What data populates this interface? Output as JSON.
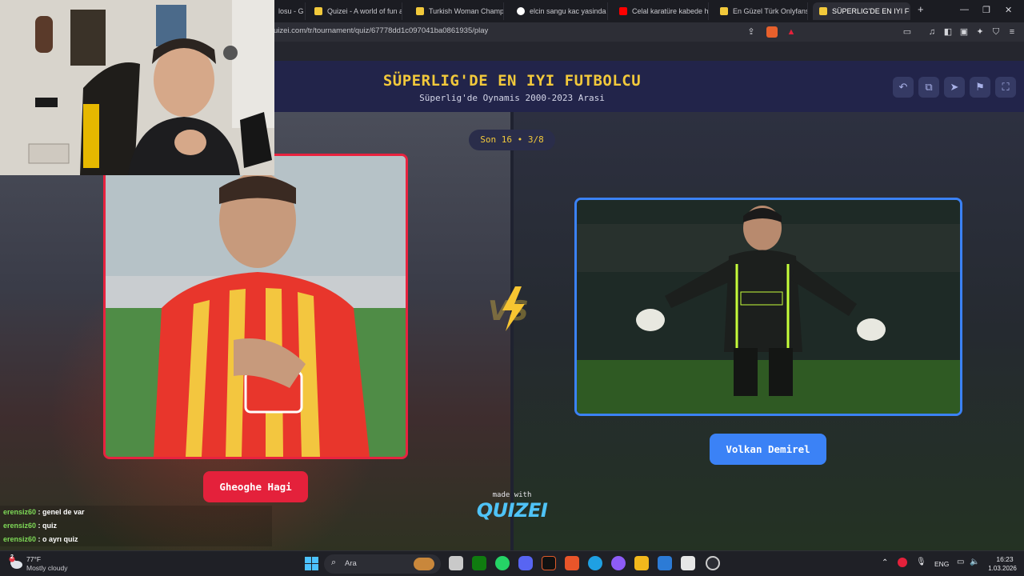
{
  "browser": {
    "tabs": [
      {
        "label": "losu - G",
        "favicon_color": "#888888"
      },
      {
        "label": "Quizei - A world of fun an",
        "favicon_color": "#f2c93b"
      },
      {
        "label": "Turkish Woman Champion",
        "favicon_color": "#f2c93b"
      },
      {
        "label": "elcin sangu kac yasinda - G",
        "favicon_color": "#ffffff"
      },
      {
        "label": "Celal karatüre kabede hac",
        "favicon_color": "#ff0000"
      },
      {
        "label": "En Güzel Türk Onlyfansc",
        "favicon_color": "#f2c93b"
      },
      {
        "label": "SÜPERLIG'DE EN IYI FU",
        "favicon_color": "#f2c93b"
      }
    ],
    "url": "uizei.com/tr/tournament/quiz/67778dd1c097041ba0861935/play",
    "window_controls": [
      "—",
      "❐",
      "✕"
    ],
    "new_tab": "+"
  },
  "quiz": {
    "title": "SÜPERLIG'DE EN IYI FUTBOLCU",
    "subtitle": "Süperlig'de Oynamis 2000-2023 Arasi",
    "round": "Son 16 • 3/8",
    "vs_text": "VS",
    "left_player": {
      "name": "Gheoghe Hagi",
      "accent": "#e4213b"
    },
    "right_player": {
      "name": "Volkan Demirel",
      "accent": "#3b82f6"
    },
    "made_with": "made with",
    "brand": "QUIZEI"
  },
  "chat": [
    {
      "user": "erensiz60",
      "message": "genel de var"
    },
    {
      "user": "erensiz60",
      "message": "quiz"
    },
    {
      "user": "erensiz60",
      "message": "o ayrı quiz"
    }
  ],
  "taskbar": {
    "weather_temp": "77°F",
    "weather_desc": "Mostly cloudy",
    "weather_badge": "2",
    "search_label": "Ara",
    "lang": "ENG",
    "time": "16:23",
    "date": "1.03.2026"
  }
}
